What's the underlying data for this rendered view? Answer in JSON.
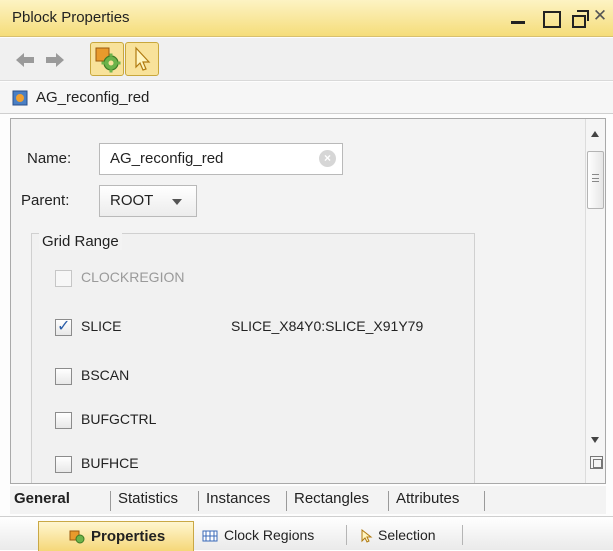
{
  "window": {
    "title": "Pblock Properties"
  },
  "toolbar": {
    "back_icon": "arrow-left-icon",
    "forward_icon": "arrow-right-icon",
    "config_icon": "gear-icon",
    "select_icon": "cursor-icon"
  },
  "object": {
    "name": "AG_reconfig_red",
    "icon": "pblock-icon"
  },
  "form": {
    "name_label": "Name:",
    "name_value": "AG_reconfig_red",
    "parent_label": "Parent:",
    "parent_value": "ROOT"
  },
  "grid_range": {
    "title": "Grid Range",
    "items": [
      {
        "label": "CLOCKREGION",
        "checked": false,
        "enabled": false,
        "range": ""
      },
      {
        "label": "SLICE",
        "checked": true,
        "enabled": true,
        "range": "SLICE_X84Y0:SLICE_X91Y79"
      },
      {
        "label": "BSCAN",
        "checked": false,
        "enabled": true,
        "range": ""
      },
      {
        "label": "BUFGCTRL",
        "checked": false,
        "enabled": true,
        "range": ""
      },
      {
        "label": "BUFHCE",
        "checked": false,
        "enabled": true,
        "range": ""
      }
    ]
  },
  "sub_tabs": [
    {
      "label": "General",
      "active": true
    },
    {
      "label": "Statistics",
      "active": false
    },
    {
      "label": "Instances",
      "active": false
    },
    {
      "label": "Rectangles",
      "active": false
    },
    {
      "label": "Attributes",
      "active": false
    }
  ],
  "window_tabs": [
    {
      "label": "Properties",
      "active": true,
      "icon": "properties-icon"
    },
    {
      "label": "Clock Regions",
      "active": false,
      "icon": "clock-regions-icon"
    },
    {
      "label": "Selection",
      "active": false,
      "icon": "cursor-icon"
    }
  ],
  "colors": {
    "title_bar": "#f5dd7a",
    "active_tab": "#f5d778",
    "checkbox_tick": "#2a5da8"
  }
}
